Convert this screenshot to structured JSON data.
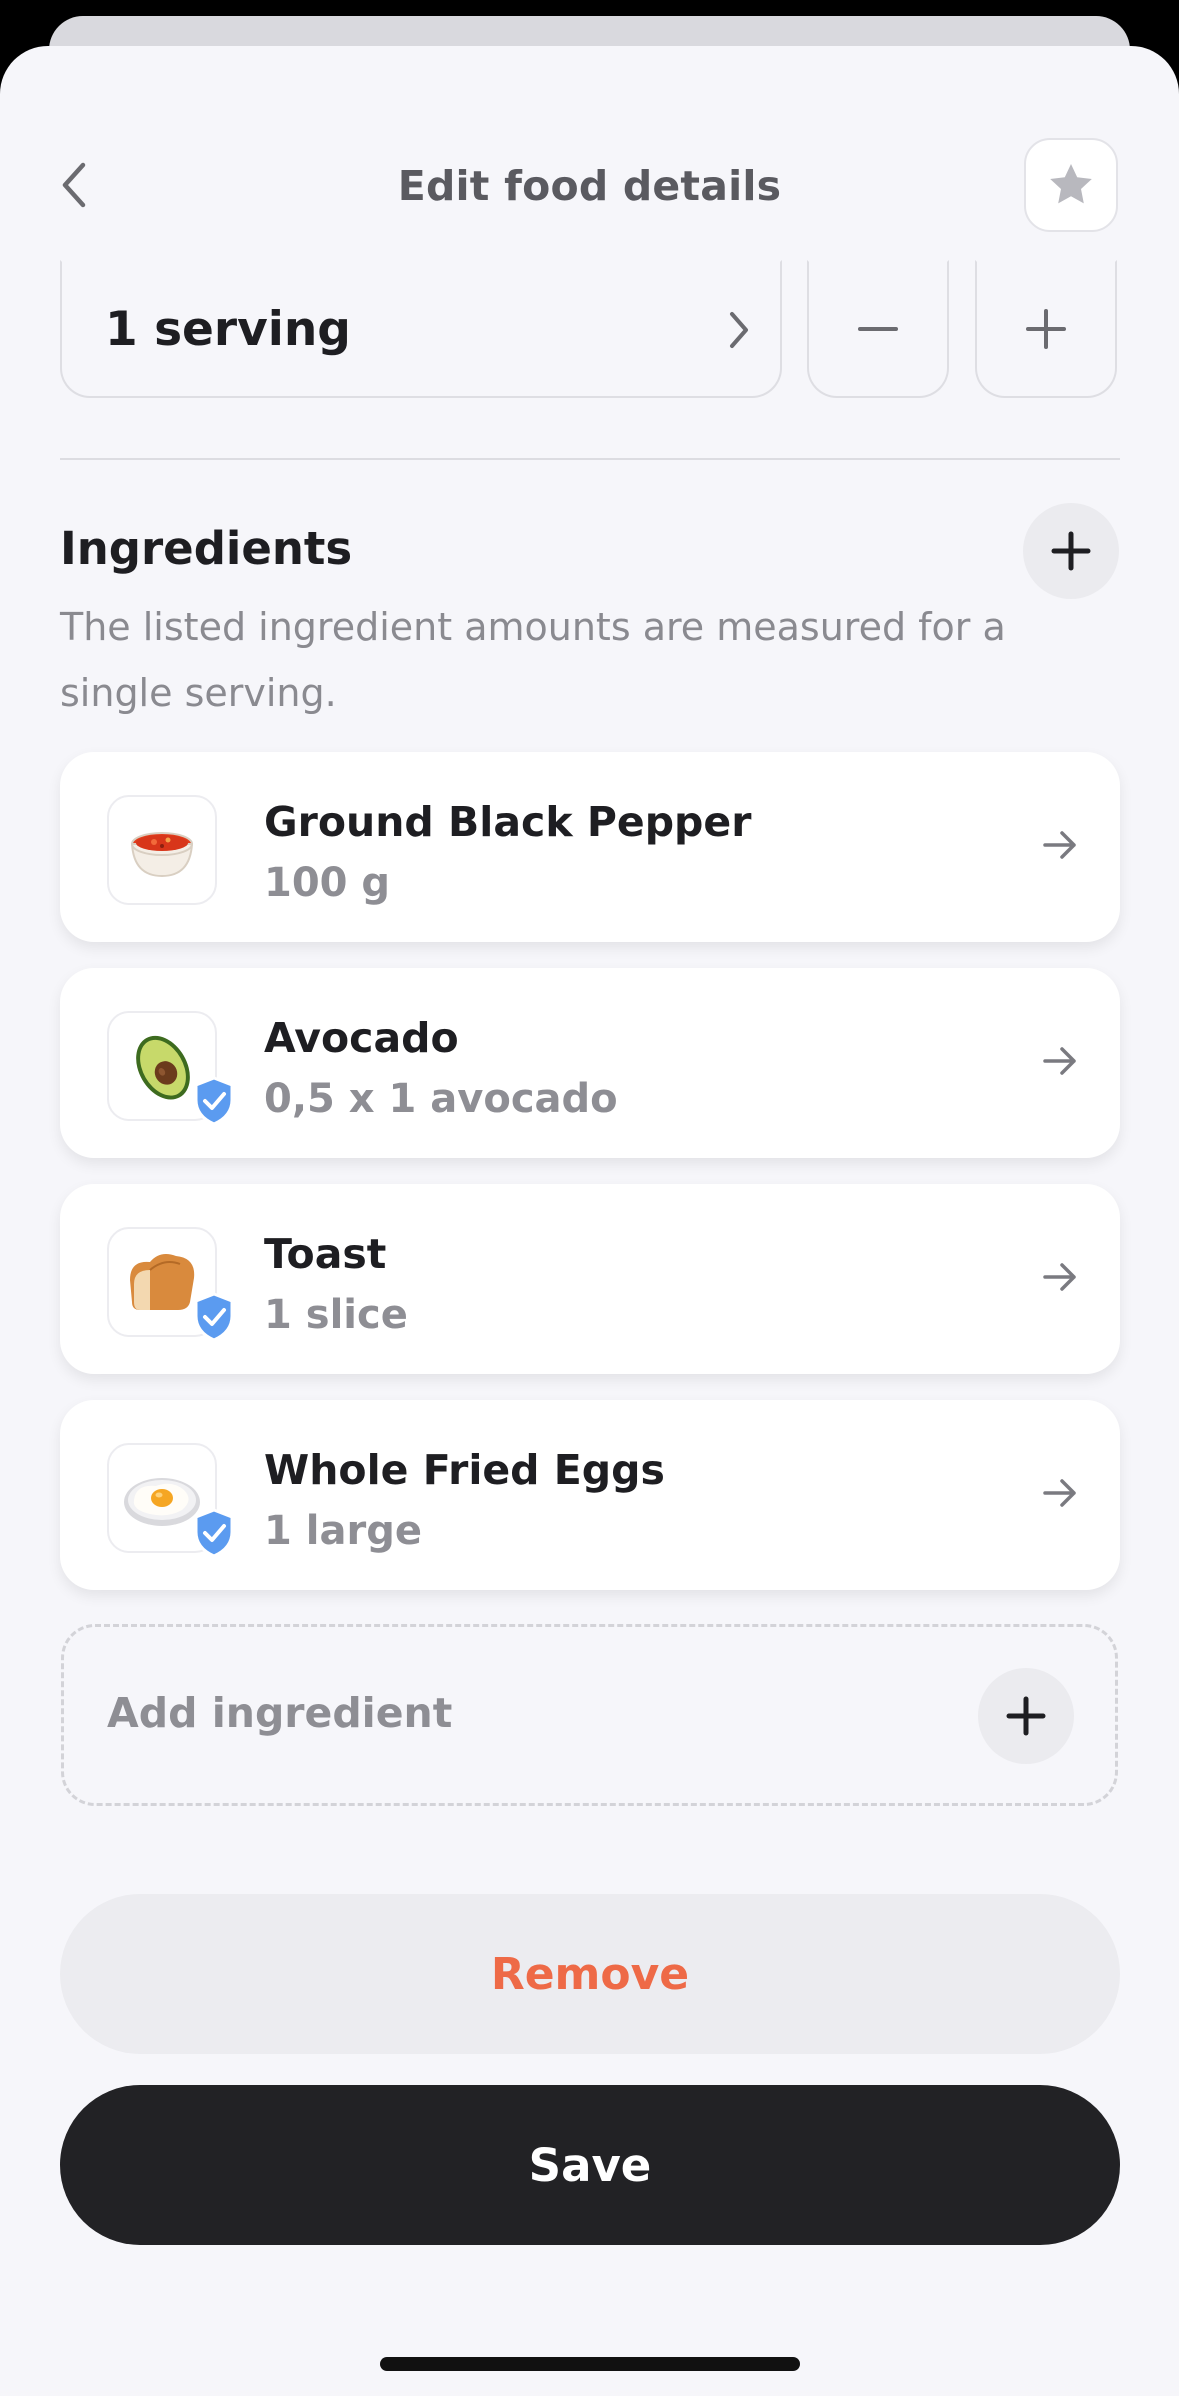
{
  "header": {
    "title": "Edit food details",
    "back_icon": "chevron-left-icon",
    "favorite_icon": "star-icon"
  },
  "serving": {
    "selected": "1 serving",
    "decrement_icon": "minus-icon",
    "increment_icon": "plus-icon"
  },
  "ingredients_section": {
    "title": "Ingredients",
    "description": "The listed ingredient amounts are measured for a single serving.",
    "add_icon": "plus-icon"
  },
  "ingredients": [
    {
      "name": "Ground Black Pepper",
      "amount": "100 g",
      "icon": "salsa-bowl-icon",
      "verified": false
    },
    {
      "name": "Avocado",
      "amount": "0,5 x 1 avocado",
      "icon": "avocado-icon",
      "verified": true
    },
    {
      "name": "Toast",
      "amount": "1 slice",
      "icon": "bread-icon",
      "verified": true
    },
    {
      "name": "Whole Fried Eggs",
      "amount": "1 large",
      "icon": "fried-egg-icon",
      "verified": true
    }
  ],
  "add_ingredient": {
    "label": "Add ingredient"
  },
  "actions": {
    "remove_label": "Remove",
    "save_label": "Save"
  },
  "colors": {
    "background": "#f6f6fa",
    "remove_text": "#ee6a47",
    "save_background": "#222225",
    "verified_badge": "#5b9bf0"
  }
}
